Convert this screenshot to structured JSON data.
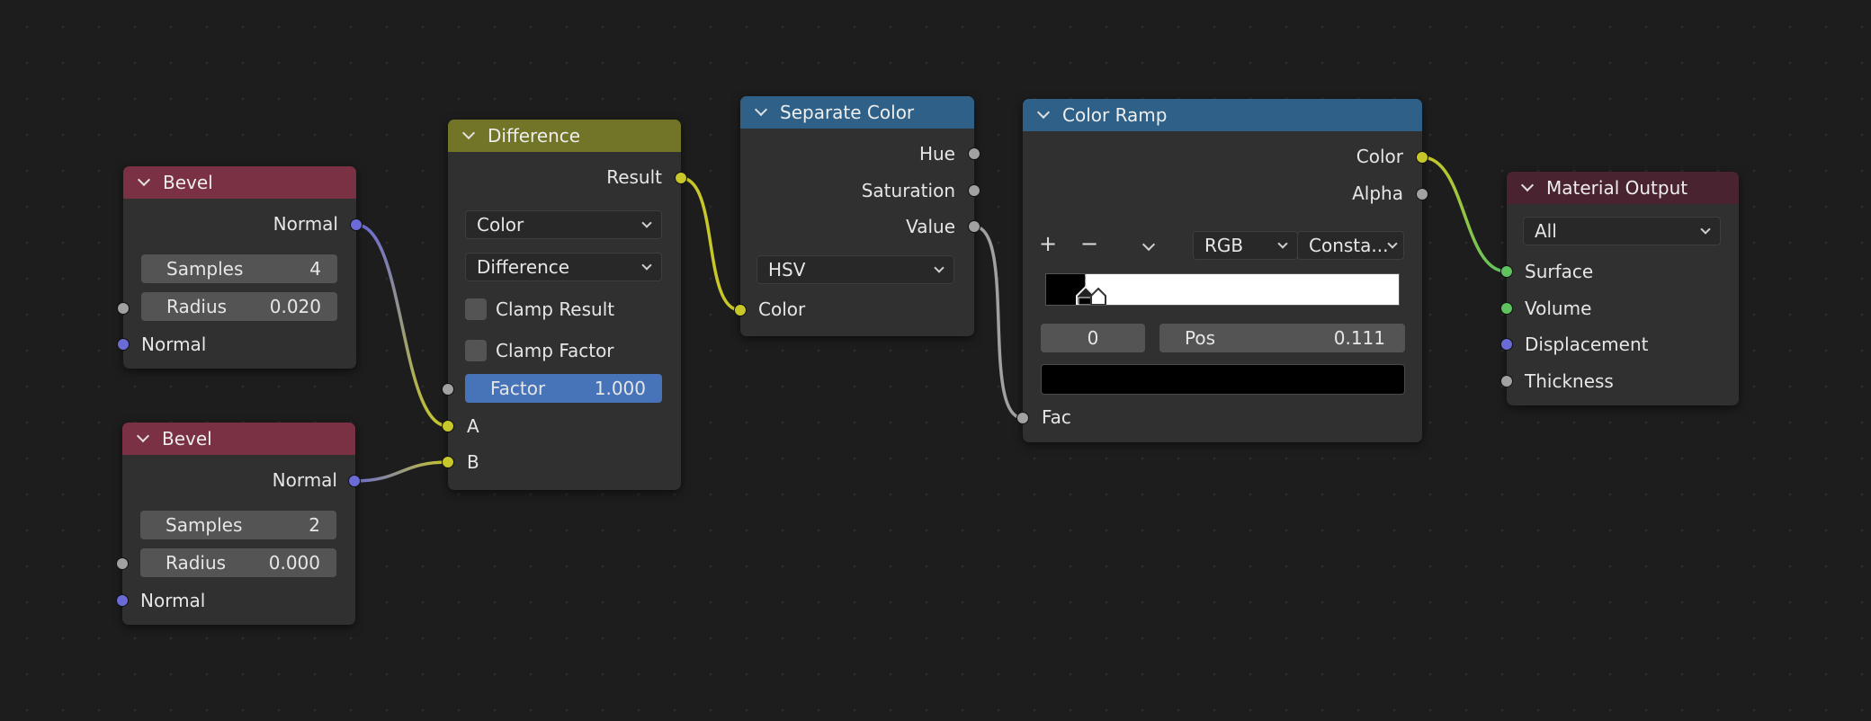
{
  "nodes": {
    "bevel1": {
      "title": "Bevel",
      "output_normal": "Normal",
      "samples_label": "Samples",
      "samples_value": "4",
      "radius_label": "Radius",
      "radius_value": "0.020",
      "input_normal": "Normal"
    },
    "bevel2": {
      "title": "Bevel",
      "output_normal": "Normal",
      "samples_label": "Samples",
      "samples_value": "2",
      "radius_label": "Radius",
      "radius_value": "0.000",
      "input_normal": "Normal"
    },
    "difference": {
      "title": "Difference",
      "output_result": "Result",
      "data_type": "Color",
      "blend_mode": "Difference",
      "clamp_result": "Clamp Result",
      "clamp_factor": "Clamp Factor",
      "factor_label": "Factor",
      "factor_value": "1.000",
      "input_a": "A",
      "input_b": "B"
    },
    "separate_color": {
      "title": "Separate Color",
      "output_hue": "Hue",
      "output_saturation": "Saturation",
      "output_value": "Value",
      "mode": "HSV",
      "input_color": "Color"
    },
    "color_ramp": {
      "title": "Color Ramp",
      "output_color": "Color",
      "output_alpha": "Alpha",
      "add_symbol": "+",
      "remove_symbol": "−",
      "color_mode": "RGB",
      "interpolation": "Consta...",
      "stop_index": "0",
      "pos_label": "Pos",
      "pos_value": "0.111",
      "input_fac": "Fac",
      "stop_fraction": 0.111
    },
    "material_output": {
      "title": "Material Output",
      "target": "All",
      "input_surface": "Surface",
      "input_volume": "Volume",
      "input_displacement": "Displacement",
      "input_thickness": "Thickness"
    }
  },
  "colors": {
    "background": "#1d1d1d",
    "node_body": "#303030",
    "bevel_header": "#7a3144",
    "difference_header": "#727427",
    "separate_header": "#2f6188",
    "ramp_header": "#2f6188",
    "output_header": "#4a2330",
    "socket_vector": "#6b6bd6",
    "socket_color": "#c7c729",
    "socket_float": "#a1a1a1",
    "socket_shader": "#5fc25f",
    "factor_field": "#4773b8"
  }
}
